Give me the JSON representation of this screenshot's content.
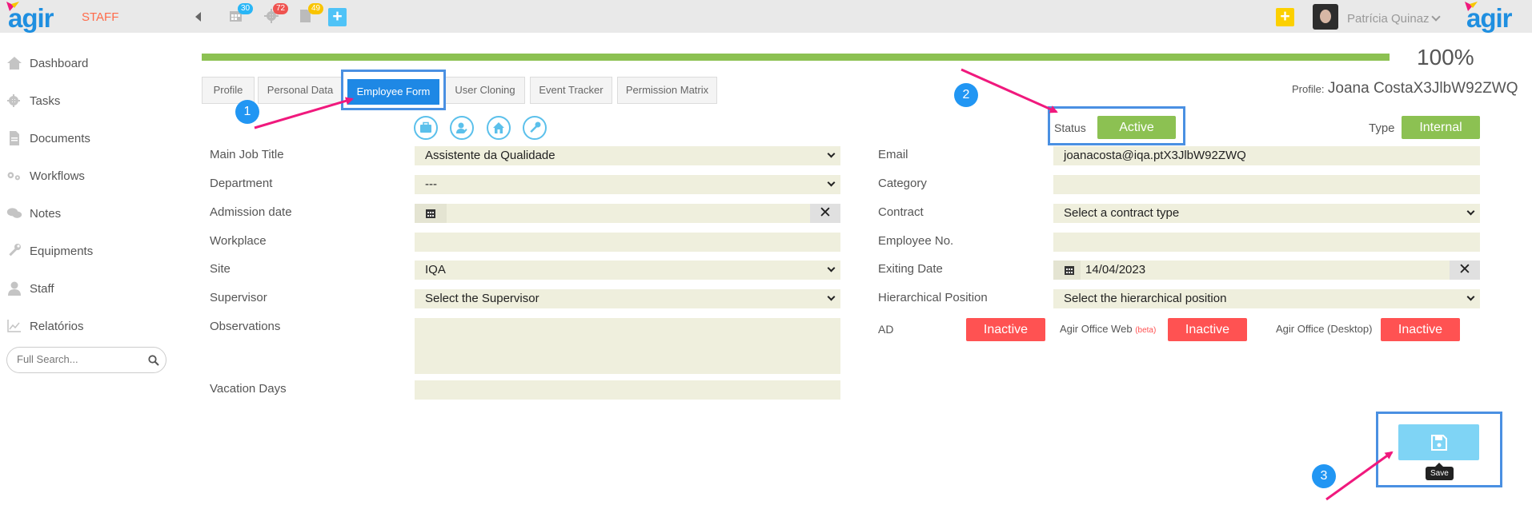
{
  "header": {
    "logo_text": "agir",
    "app_label": "STAFF",
    "badges": {
      "calendar": "30",
      "tasks": "72",
      "documents": "49"
    },
    "user_name": "Patrícia Quinaz"
  },
  "sidebar": {
    "items": [
      {
        "label": "Dashboard",
        "icon": "home-icon"
      },
      {
        "label": "Tasks",
        "icon": "gears-icon"
      },
      {
        "label": "Documents",
        "icon": "document-icon"
      },
      {
        "label": "Workflows",
        "icon": "workflow-icon"
      },
      {
        "label": "Notes",
        "icon": "comments-icon"
      },
      {
        "label": "Equipments",
        "icon": "wrench-icon"
      },
      {
        "label": "Staff",
        "icon": "user-icon"
      },
      {
        "label": "Relatórios",
        "icon": "chart-icon"
      }
    ],
    "search_placeholder": "Full Search..."
  },
  "progress": {
    "value": 100,
    "label": "100%"
  },
  "tabs": [
    {
      "label": "Profile",
      "active": false
    },
    {
      "label": "Personal Data",
      "active": false
    },
    {
      "label": "Employee Form",
      "active": true
    },
    {
      "label": "User Cloning",
      "active": false
    },
    {
      "label": "Event Tracker",
      "active": false
    },
    {
      "label": "Permission Matrix",
      "active": false
    }
  ],
  "profile": {
    "prefix": "Profile:",
    "name": "Joana CostaX3JlbW92ZWQ"
  },
  "status": {
    "label": "Status",
    "value": "Active"
  },
  "type": {
    "label": "Type",
    "value": "Internal"
  },
  "form_left": {
    "main_job_title": {
      "label": "Main Job Title",
      "value": "Assistente da Qualidade"
    },
    "department": {
      "label": "Department",
      "value": "---"
    },
    "admission_date": {
      "label": "Admission date",
      "value": ""
    },
    "workplace": {
      "label": "Workplace",
      "value": ""
    },
    "site": {
      "label": "Site",
      "value": "IQA"
    },
    "supervisor": {
      "label": "Supervisor",
      "value": "Select the Supervisor"
    },
    "observations": {
      "label": "Observations",
      "value": ""
    },
    "vacation_days": {
      "label": "Vacation Days",
      "value": ""
    }
  },
  "form_right": {
    "email": {
      "label": "Email",
      "value": "joanacosta@iqa.ptX3JlbW92ZWQ"
    },
    "category": {
      "label": "Category",
      "value": ""
    },
    "contract": {
      "label": "Contract",
      "value": "Select a contract type"
    },
    "employee_no": {
      "label": "Employee No.",
      "value": ""
    },
    "exiting_date": {
      "label": "Exiting Date",
      "value": "14/04/2023"
    },
    "hierarchical_position": {
      "label": "Hierarchical Position",
      "value": "Select the hierarchical position"
    }
  },
  "access": {
    "ad": {
      "label": "AD",
      "value": "Inactive"
    },
    "office_web": {
      "label": "Agir Office Web",
      "beta": "(beta)",
      "value": "Inactive"
    },
    "office_desktop": {
      "label": "Agir Office (Desktop)",
      "value": "Inactive"
    }
  },
  "save": {
    "tooltip": "Save"
  },
  "annotations": {
    "step1": "1",
    "step2": "2",
    "step3": "3"
  },
  "colors": {
    "primary": "#1e88e5",
    "success": "#8cc152",
    "danger": "#ff5252",
    "field_bg": "#efefdd",
    "annotation_arrow": "#f0197d",
    "annotation_box": "#4a90e2"
  }
}
